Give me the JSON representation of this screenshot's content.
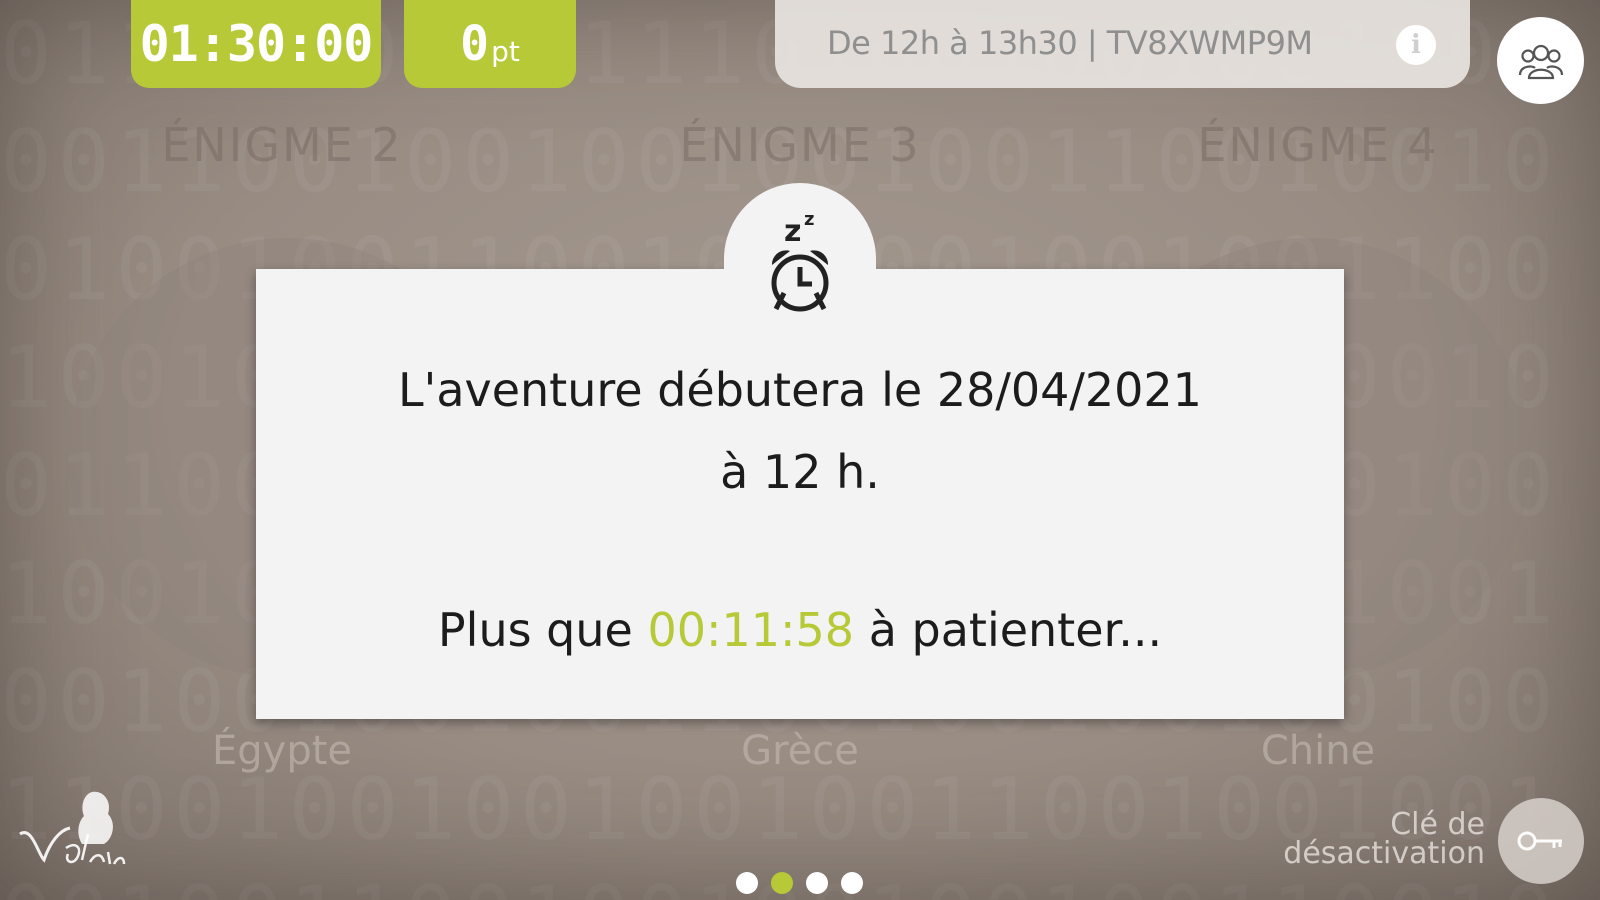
{
  "header": {
    "timer": "01:30:00",
    "points_value": "0",
    "points_unit": "pt",
    "session_info": "De 12h à 13h30 | TV8XWMP9M",
    "info_label": "i"
  },
  "enigmas": [
    {
      "title": "ÉNIGME 2",
      "country": "Égypte"
    },
    {
      "title": "ÉNIGME 3",
      "country": "Grèce"
    },
    {
      "title": "ÉNIGME 4",
      "country": "Chine"
    }
  ],
  "modal": {
    "line1": "L'aventure débutera le 28/04/2021",
    "line2": "à 12 h.",
    "wait_prefix": "Plus que",
    "countdown": "00:11:58",
    "wait_suffix": "à patienter..."
  },
  "pagination": {
    "total": 4,
    "active_index": 1
  },
  "footer": {
    "key_label_line1": "Clé de",
    "key_label_line2": "désactivation"
  },
  "colors": {
    "accent": "#b7c936",
    "modal_bg": "#f3f3f3"
  },
  "icons": [
    "alarm-clock-icon",
    "team-icon",
    "info-icon",
    "key-icon"
  ]
}
